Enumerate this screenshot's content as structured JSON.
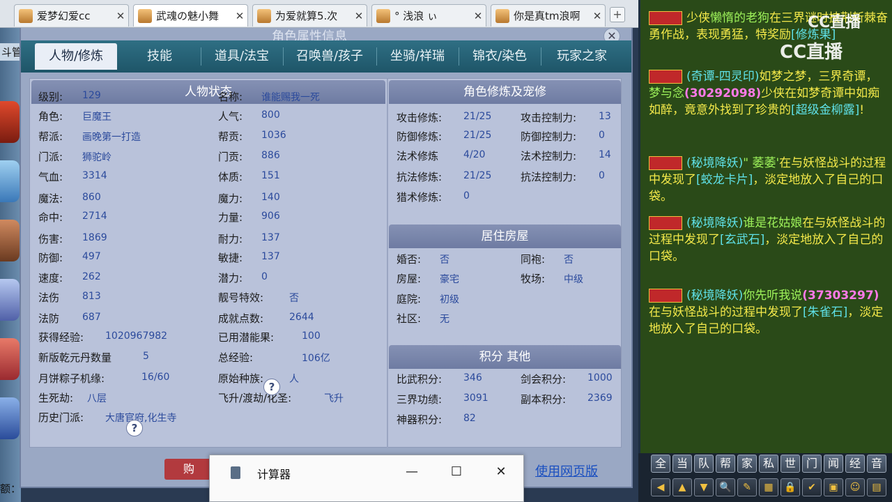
{
  "browser_tabs": [
    {
      "label": "爱梦幻爱cc"
    },
    {
      "label": "武魂の魅小舞"
    },
    {
      "label": "为爱就算5.次"
    },
    {
      "label": "°  浅浪 ぃ"
    },
    {
      "label": "你是真tm浪啊"
    }
  ],
  "tab_close_glyph": "✕",
  "new_tab_glyph": "+",
  "left_edge": {
    "label": "斗管",
    "bottom_text": "额："
  },
  "window": {
    "title": "角色属性信息",
    "close_glyph": "✕",
    "tabs": [
      "人物/修炼",
      "技能",
      "道具/法宝",
      "召唤兽/孩子",
      "坐骑/祥瑞",
      "锦衣/染色",
      "玩家之家"
    ],
    "active_tab": "人物/修炼",
    "buy_button": "购",
    "web_link": "使用网页版"
  },
  "status_section": {
    "title": "人物状态",
    "left": [
      {
        "label": "级别:",
        "value": "129"
      },
      {
        "label": "角色:",
        "value": "巨魔王"
      },
      {
        "label": "帮派:",
        "value": "画晚第一打造"
      },
      {
        "label": "门派:",
        "value": "狮驼岭"
      },
      {
        "label": "气血:",
        "value": "3314"
      },
      {
        "label": "魔法:",
        "value": "860"
      },
      {
        "label": "命中:",
        "value": "2714"
      },
      {
        "label": "伤害:",
        "value": "1869"
      },
      {
        "label": "防御:",
        "value": "497"
      },
      {
        "label": "速度:",
        "value": "262"
      },
      {
        "label": "法伤",
        "value": "813"
      },
      {
        "label": "法防",
        "value": "687"
      },
      {
        "label": "获得经验:",
        "value": "1020967982"
      },
      {
        "label": "新版乾元丹数量",
        "value": "5"
      },
      {
        "label": "月饼粽子机缘:",
        "value": "16/60"
      },
      {
        "label": "生死劫:",
        "value": "八层"
      },
      {
        "label": "历史门派:",
        "value": "大唐官府,化生寺"
      }
    ],
    "right": [
      {
        "label": "名称:",
        "value": "谁能赐我一死"
      },
      {
        "label": "人气:",
        "value": "800"
      },
      {
        "label": "帮贡:",
        "value": "1036"
      },
      {
        "label": "门贡:",
        "value": "886"
      },
      {
        "label": "体质:",
        "value": "151"
      },
      {
        "label": "魔力:",
        "value": "140"
      },
      {
        "label": "力量:",
        "value": "906"
      },
      {
        "label": "耐力:",
        "value": "137"
      },
      {
        "label": "敏捷:",
        "value": "137"
      },
      {
        "label": "潜力:",
        "value": "0"
      },
      {
        "label": "靓号特效:",
        "value": "否"
      },
      {
        "label": "成就点数:",
        "value": "2644"
      },
      {
        "label": "已用潜能果:",
        "value": "100"
      },
      {
        "label": "总经验:",
        "value": "106亿"
      },
      {
        "label": "原始种族:",
        "value": "人"
      },
      {
        "label": "飞升/渡劫/化圣:",
        "value": "飞升"
      }
    ],
    "help_glyph": "?"
  },
  "cultivation_section": {
    "title": "角色修炼及宠修",
    "rows": [
      {
        "label": "攻击修炼:",
        "value": "21/25",
        "label2": "攻击控制力:",
        "value2": "13"
      },
      {
        "label": "防御修炼:",
        "value": "21/25",
        "label2": "防御控制力:",
        "value2": "0"
      },
      {
        "label": "法术修炼",
        "value": "4/20",
        "label2": "法术控制力:",
        "value2": "14"
      },
      {
        "label": "抗法修炼:",
        "value": "21/25",
        "label2": "抗法控制力:",
        "value2": "0"
      },
      {
        "label": "猎术修炼:",
        "value": "0",
        "label2": "",
        "value2": ""
      }
    ]
  },
  "house_section": {
    "title": "居住房屋",
    "rows": [
      {
        "label": "婚否:",
        "value": "否",
        "label2": "同袍:",
        "value2": "否"
      },
      {
        "label": "房屋:",
        "value": "豪宅",
        "label2": "牧场:",
        "value2": "中级"
      },
      {
        "label": "庭院:",
        "value": "初级",
        "label2": "",
        "value2": ""
      },
      {
        "label": "社区:",
        "value": "无",
        "label2": "",
        "value2": ""
      }
    ]
  },
  "score_section": {
    "title": "积分 其他",
    "rows": [
      {
        "label": "比武积分:",
        "value": "346",
        "label2": "剑会积分:",
        "value2": "1000"
      },
      {
        "label": "三界功绩:",
        "value": "3091",
        "label2": "副本积分:",
        "value2": "2369"
      },
      {
        "label": "神器积分:",
        "value": "82",
        "label2": "",
        "value2": ""
      }
    ]
  },
  "calculator": {
    "title": "计算器",
    "minimize": "—",
    "maximize": "☐",
    "close": "✕"
  },
  "chat": {
    "watermark": "CC直播",
    "messages": [
      {
        "a": "少侠",
        "b": "懒惰的老狗",
        "c": "在三界谜时披荆斩棘奋勇作战，表现勇猛，特奖励",
        "d": "[修炼果]"
      },
      {
        "a": "(奇谭-四灵印)",
        "b": "如梦之梦，三界奇谭，",
        "c": "梦与念",
        "d": "(30292098)",
        "e": "少侠在如梦奇谭中如痴如醉，竟意外找到了珍贵的",
        "f": "[超级金柳露]",
        "g": "!"
      },
      {
        "a": "(秘境降妖)",
        "b": "\" 萎萎'",
        "c": "在与妖怪战斗的过程中发现了",
        "d": "[蛟龙卡片]",
        "e": "，淡定地放入了自己的口袋。"
      },
      {
        "a": "(秘境降妖)",
        "b": "谁是花姑娘",
        "c": "在与妖怪战斗的过程中发现了",
        "d": "[玄武石]",
        "e": "，淡定地放入了自己的口袋。"
      },
      {
        "a": "(秘境降妖)",
        "b": "你先听我说",
        "c": "(37303297)",
        "d": "在与妖怪战斗的过程中发现了",
        "e": "[朱雀石]",
        "f": "，淡定地放入了自己的口袋。"
      }
    ]
  },
  "chat_channels": [
    "全",
    "当",
    "队",
    "帮",
    "家",
    "私",
    "世",
    "门",
    "闻",
    "经",
    "音"
  ],
  "chat_tools": [
    "◀",
    "▲",
    "▼",
    "🔍",
    "✎",
    "▦",
    "🔒",
    "✔",
    "▣",
    "☺",
    "▤"
  ]
}
